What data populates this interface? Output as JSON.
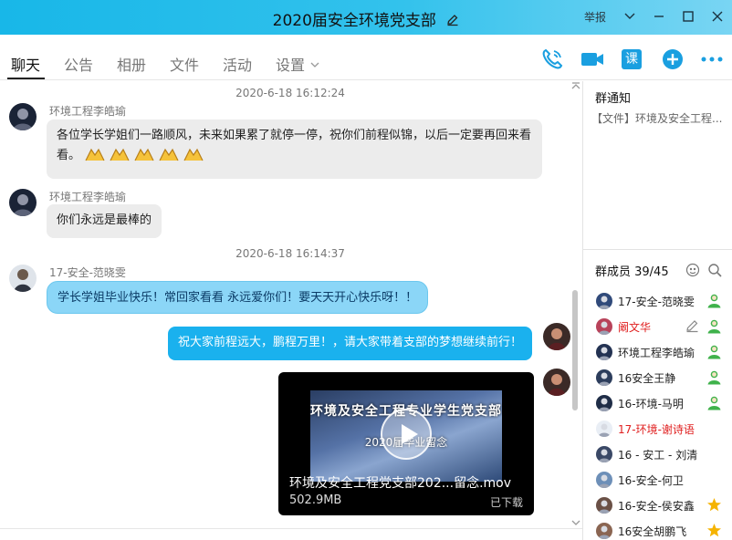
{
  "window": {
    "title": "2020届安全环境党支部",
    "report_label": "举报",
    "accent": "#1ab1ee"
  },
  "tabs": [
    {
      "label": "聊天",
      "active": true
    },
    {
      "label": "公告"
    },
    {
      "label": "相册"
    },
    {
      "label": "文件"
    },
    {
      "label": "活动"
    },
    {
      "label": "设置"
    }
  ],
  "toolbar": {
    "icons": [
      "phone-icon",
      "video-call-icon",
      "lesson-icon",
      "add-icon",
      "more-icon"
    ],
    "lesson_label": "课"
  },
  "chat": {
    "messages": [
      {
        "time": "2020-6-18 16:12:24"
      },
      {
        "sender": "环境工程李皓瑜",
        "text": "各位学长学姐们一路顺风，未来如果累了就停一停，祝你们前程似锦，以后一定要再回来看看。"
      },
      {
        "sender": "环境工程李皓瑜",
        "text": "你们永远是最棒的"
      },
      {
        "time": "2020-6-18 16:14:37"
      },
      {
        "sender": "17-安全-范晓雯",
        "text": "学长学姐毕业快乐！常回家看看 永远爱你们！要天天开心快乐呀！！"
      },
      {
        "sender": "",
        "text": "祝大家前程远大，鹏程万里！，请大家带着支部的梦想继续前行！"
      },
      {
        "video": {
          "thumb_title": "环境及安全工程专业学生党支部",
          "thumb_subtitle": "2020届毕业留念",
          "filename": "环境及安全工程党支部202...留念.mov",
          "size": "502.9MB",
          "status": "已下载"
        }
      }
    ]
  },
  "side": {
    "notice_title": "群通知",
    "notice_body": "【文件】环境及安全工程...",
    "members_title": "群成员 39/45",
    "members": [
      {
        "name": "17-安全-范晓雯",
        "color": "#222",
        "badge": "person"
      },
      {
        "name": "阚文华",
        "color": "#e02020",
        "badge": "person",
        "editable": true
      },
      {
        "name": "环境工程李皓瑜",
        "color": "#222",
        "badge": "person"
      },
      {
        "name": "16安全王静",
        "color": "#222",
        "badge": "person"
      },
      {
        "name": "16-环境-马明",
        "color": "#222",
        "badge": "person"
      },
      {
        "name": "17-环境-谢诗语",
        "color": "#e02020",
        "badge": ""
      },
      {
        "name": "16 - 安工 - 刘清",
        "color": "#222",
        "badge": ""
      },
      {
        "name": "16-安全-何卫",
        "color": "#222",
        "badge": ""
      },
      {
        "name": "16-安全-侯安鑫",
        "color": "#222",
        "badge": "star"
      },
      {
        "name": "16安全胡鹏飞",
        "color": "#222",
        "badge": "star"
      }
    ]
  }
}
